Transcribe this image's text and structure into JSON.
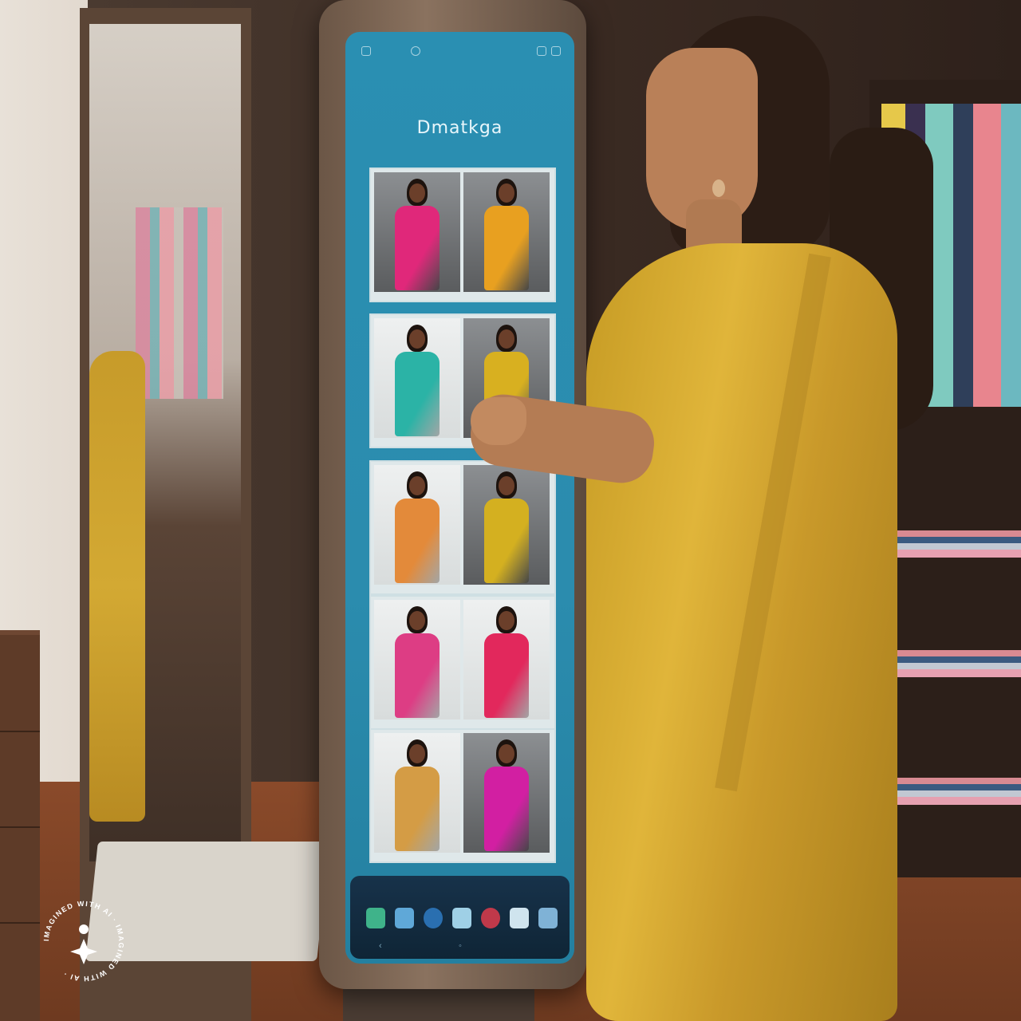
{
  "screen": {
    "app_title": "Dmatkga",
    "status_icons": [
      "settings-icon",
      "share-icon",
      "wifi-icon",
      "battery-icon"
    ],
    "photo_rows": [
      {
        "left": {
          "saree_color": "#e0287a",
          "bg": "dark"
        },
        "right": {
          "saree_color": "#e8a020",
          "bg": "dark"
        }
      },
      {
        "left": {
          "saree_color": "#2bb3a6",
          "bg": "light"
        },
        "right": {
          "saree_color": "#d8b020",
          "bg": "dark"
        }
      },
      {
        "left": {
          "saree_color": "#e38a3a",
          "bg": "light"
        },
        "right": {
          "saree_color": "#d4b020",
          "bg": "dark"
        }
      },
      {
        "left": {
          "saree_color": "#dd3d84",
          "bg": "light"
        },
        "right": {
          "saree_color": "#e2285c",
          "bg": "light"
        }
      },
      {
        "left": {
          "saree_color": "#d49c45",
          "bg": "light"
        },
        "right": {
          "saree_color": "#d21fa2",
          "bg": "dark"
        }
      }
    ],
    "dock": {
      "icons": [
        {
          "name": "gallery-icon",
          "color": "#3fb38a"
        },
        {
          "name": "cloud-icon",
          "color": "#5fa8d8"
        },
        {
          "name": "globe-icon",
          "color": "#2a6fb0"
        },
        {
          "name": "triangle-icon",
          "color": "#9fd0e6"
        },
        {
          "name": "record-icon",
          "color": "#c0394a"
        },
        {
          "name": "drop-icon",
          "color": "#cfe4ee"
        },
        {
          "name": "bookmark-icon",
          "color": "#7fb2d6"
        }
      ]
    }
  },
  "watermark": {
    "text": "IMAGINED WITH AI · IMAGINED WITH AI ·"
  }
}
